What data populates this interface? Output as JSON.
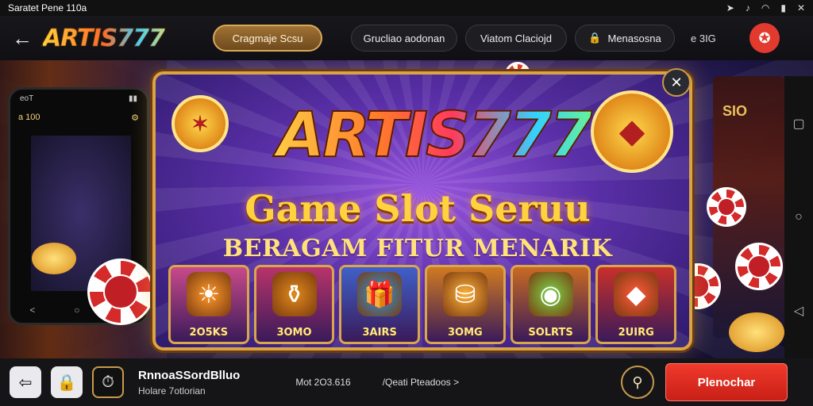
{
  "status_bar": {
    "left_text": "Saratet Pene 110a",
    "icons": [
      "location-icon",
      "sound-icon",
      "wifi-icon",
      "signal-icon",
      "close-icon"
    ]
  },
  "top_nav": {
    "logo_text": "ARTIS777",
    "pill_gold": "Cragmaje Scsu",
    "pill_1": "Grucliao aodonan",
    "pill_2": "Viatom Claciojd",
    "pill_3": "Menasosna",
    "pill_3_icon": "lock-icon",
    "clock_text": "e 3IG",
    "alert_icon": "alert-icon"
  },
  "phone_mockup": {
    "status_left": "eoT",
    "head_left": "a 100",
    "nav_left": "<"
  },
  "banner": {
    "title": "ARTIS777",
    "subtitle": "Game Slot Seruu",
    "tagline": "BERAGAM FITUR MENARIK",
    "tiles": [
      {
        "label": "2O5KS",
        "icon": "sun-icon",
        "bg": "#c84a8a",
        "icon_bg": "#ff9a2a",
        "glyph": "☀"
      },
      {
        "label": "3OMO",
        "icon": "treasure-icon",
        "bg": "#b8346a",
        "icon_bg": "#e08a1a",
        "glyph": "⚱"
      },
      {
        "label": "3AIRS",
        "icon": "giftbox-icon",
        "bg": "#4060c8",
        "icon_bg": "#2a9ae8",
        "glyph": "🎁"
      },
      {
        "label": "3OMG",
        "icon": "coins-icon",
        "bg": "#d07a20",
        "icon_bg": "#ffb23a",
        "glyph": "⛁"
      },
      {
        "label": "SOLRTS",
        "icon": "gem-icon",
        "bg": "#c86a22",
        "icon_bg": "#7ad84a",
        "glyph": "◉"
      },
      {
        "label": "2UIRG",
        "icon": "chest-icon",
        "bg": "#c8302a",
        "icon_bg": "#ff5a3a",
        "glyph": "◆"
      }
    ]
  },
  "right_machine_label": "SIO",
  "bottom_bar": {
    "title": "RnnoaSSordBlluo",
    "subtitle": "Holare 7otlorian",
    "meta_1": "Mot 2O3.616",
    "meta_2": "/Qeati Pteadoos >",
    "cta_label": "Plenochar"
  }
}
